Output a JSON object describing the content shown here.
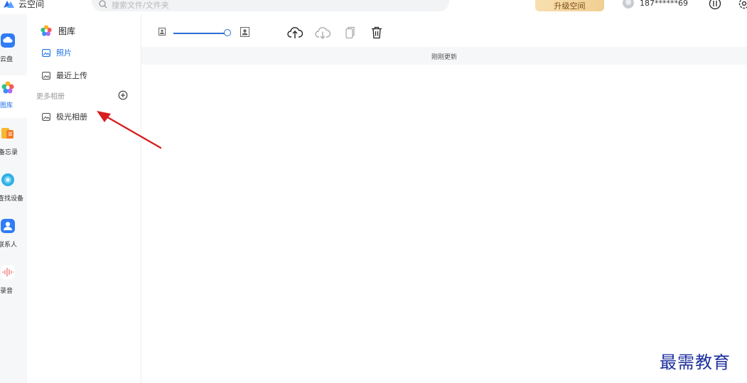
{
  "app": {
    "title": "云空间"
  },
  "search": {
    "placeholder": "搜索文件/文件夹"
  },
  "header": {
    "upgrade_label": "升级空间",
    "user_name": "187******69"
  },
  "rail": {
    "items": [
      {
        "label": "云盘",
        "icon": "cloud-drive-icon"
      },
      {
        "label": "图库",
        "icon": "gallery-icon"
      },
      {
        "label": "备忘录",
        "icon": "notes-icon"
      },
      {
        "label": "查找设备",
        "icon": "find-device-icon"
      },
      {
        "label": "联系人",
        "icon": "contacts-icon"
      },
      {
        "label": "录音",
        "icon": "recorder-icon"
      }
    ]
  },
  "sidebar": {
    "title": "图库",
    "items": [
      {
        "label": "照片"
      },
      {
        "label": "最近上传"
      }
    ],
    "section_label": "更多相册",
    "albums": [
      {
        "label": "极光相册"
      }
    ]
  },
  "status": {
    "text": "刚刚更新"
  },
  "watermark": {
    "text": "最需教育"
  },
  "colors": {
    "accent": "#1f6feb",
    "arrow": "#d81e1e",
    "watermark": "#1d2f9e"
  }
}
